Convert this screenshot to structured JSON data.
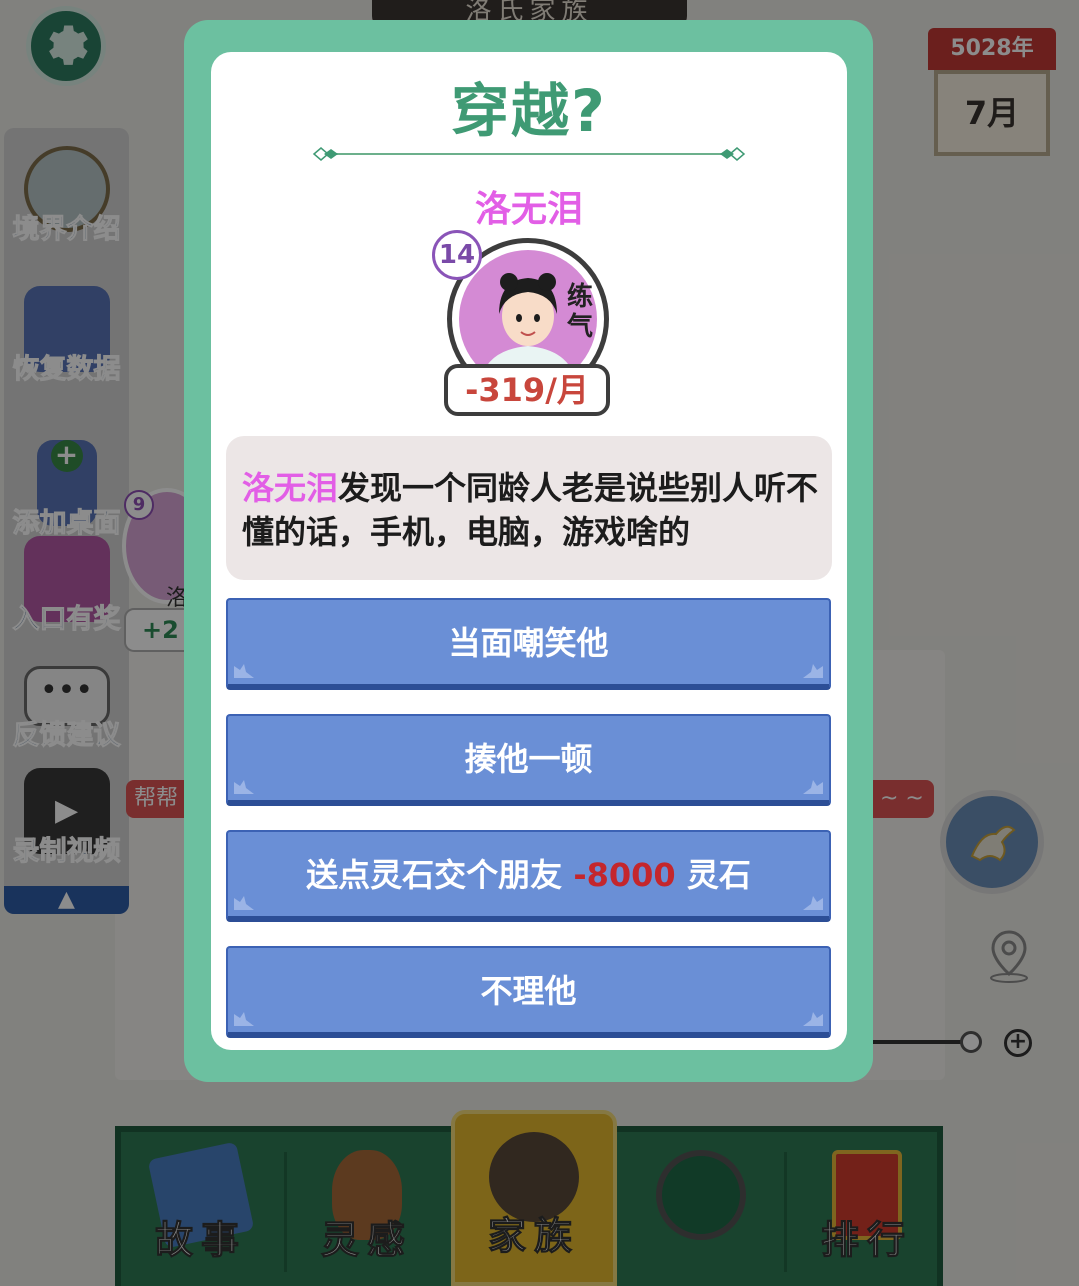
{
  "background": {
    "family_title": "洛氏家族",
    "calendar": {
      "year": "5028年",
      "month": "7月"
    },
    "sidebar": [
      {
        "label": "境界介绍",
        "icon": "meditation-icon"
      },
      {
        "label": "恢复数据",
        "icon": "cloud-save-icon"
      },
      {
        "label": "添加桌面",
        "icon": "add-desktop-icon"
      },
      {
        "label": "入口有奖",
        "icon": "gift-icon"
      },
      {
        "label": "反馈建议",
        "icon": "chat-icon"
      },
      {
        "label": "录制视频",
        "icon": "clapper-icon"
      }
    ],
    "sidebar_toggle": "▲",
    "left_member": {
      "level": "9",
      "name_fragment": "洛",
      "income_fragment": "+2"
    },
    "ribbon_left": "帮帮",
    "ribbon_right": "~ ~",
    "tabs": [
      {
        "label": "故事",
        "icon": "book-icon"
      },
      {
        "label": "灵感",
        "icon": "gourd-icon"
      },
      {
        "label": "家族",
        "icon": "family-icon",
        "active": true
      },
      {
        "label": "",
        "icon": "locked-chain-icon"
      },
      {
        "label": "排行",
        "icon": "ranking-banner-icon"
      }
    ]
  },
  "modal": {
    "title": "穿越?",
    "character": {
      "name": "洛无泪",
      "level": "14",
      "realm": "练气",
      "income": "-319/月"
    },
    "story": {
      "name": "洛无泪",
      "text": "发现一个同龄人老是说些别人听不懂的话，手机，电脑，游戏啥的"
    },
    "choices": [
      {
        "label": "当面嘲笑他"
      },
      {
        "label": "揍他一顿"
      },
      {
        "label_prefix": "送点灵石交个朋友 ",
        "cost": "-8000",
        "label_suffix": " 灵石"
      },
      {
        "label": "不理他"
      }
    ]
  },
  "colors": {
    "modal_border": "#6cc0a0",
    "title": "#3f9a74",
    "name_pink": "#e25ee6",
    "choice_blue": "#6a8fd6",
    "cost_red": "#c4262c",
    "income_red": "#c8463c"
  }
}
